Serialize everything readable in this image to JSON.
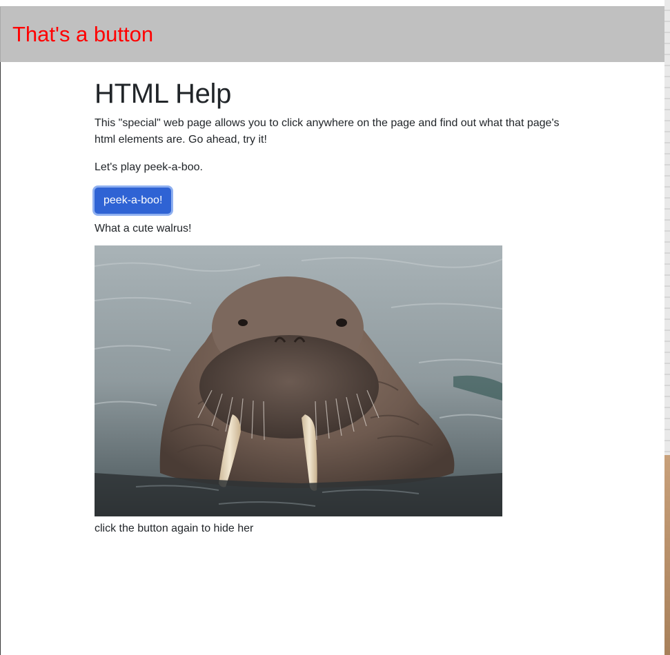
{
  "banner": {
    "text": "That's a button"
  },
  "page": {
    "title": "HTML Help",
    "intro": "This \"special\" web page allows you to click anywhere on the page and find out what that page's html elements are. Go ahead, try it!",
    "peek_prompt": "Let's play peek-a-boo.",
    "button_label": "peek-a-boo!",
    "image_caption": "What a cute walrus!",
    "hide_note": "click the button again to hide her"
  },
  "colors": {
    "banner_text": "#ff0000",
    "banner_bg": "#c0c0c0",
    "button_bg": "#2f63d4",
    "button_focus_ring": "#8fb0f0"
  }
}
